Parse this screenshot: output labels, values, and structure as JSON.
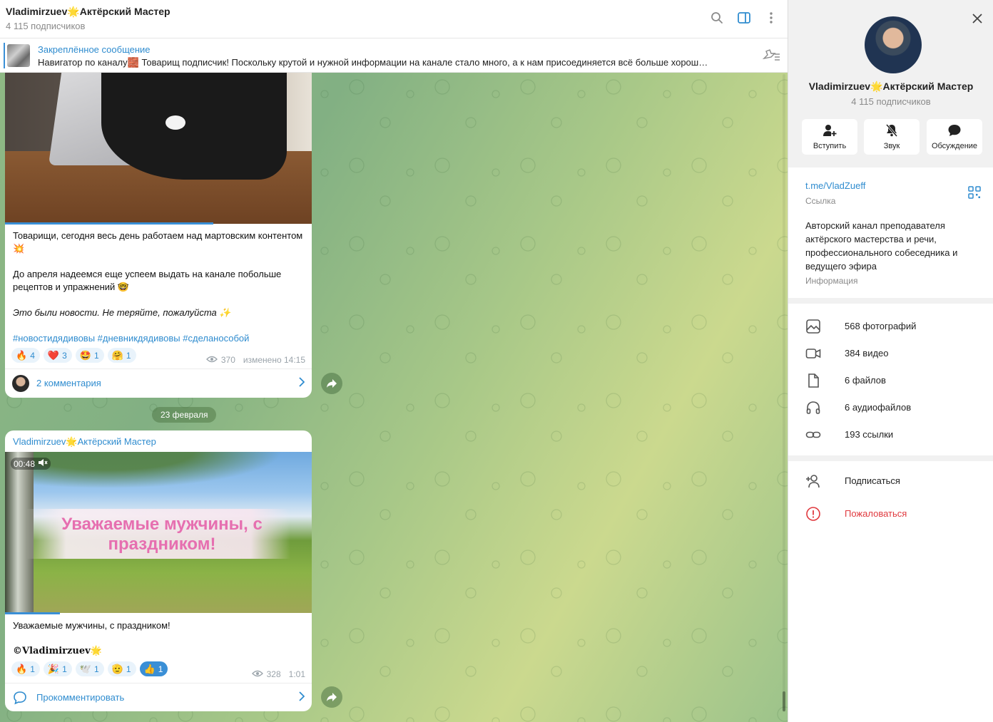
{
  "header": {
    "title": "Vladimirzuev🌟Актёрский Мастер",
    "subscribers": "4 115 подписчиков"
  },
  "pinned": {
    "title": "Закреплённое сообщение",
    "text": "Навигатор по каналу🧱 Товарищ подписчик!  Поскольку крутой и нужной информации на канале стало много, а к нам присоединяется всё больше хорош…"
  },
  "message1": {
    "lines": [
      "Товарищи, сегодня весь день работаем над мартовским контентом 💥",
      "До апреля надеемся еще успеем выдать на канале побольше рецептов и упражнений 🤓",
      "Это были новости. Не теряйте, пожалуйста ✨",
      "#новостидядивовы #дневникдядивовы #сделанособой"
    ],
    "reactions": [
      {
        "emoji": "🔥",
        "count": "4"
      },
      {
        "emoji": "❤️",
        "count": "3"
      },
      {
        "emoji": "🤩",
        "count": "1"
      },
      {
        "emoji": "🤗",
        "count": "1"
      }
    ],
    "views": "370",
    "edited": "изменено 14:15",
    "comments_label": "2 комментария",
    "video_progress": 0.68
  },
  "date_separator": "23 февраля",
  "message2": {
    "sender": "Vladimirzuev🌟Актёрский Мастер",
    "video_time": "00:48",
    "video_overlay_text": "Уважаемые мужчины, с праздником!",
    "video_progress": 0.18,
    "text_line1": "Уважаемые мужчины, с праздником!",
    "signature": "©𝐕𝐥𝐚𝐝𝐢𝐦𝐢𝐫𝐳𝐮𝐞𝐯🌟",
    "reactions": [
      {
        "emoji": "🔥",
        "count": "1"
      },
      {
        "emoji": "🎉",
        "count": "1"
      },
      {
        "emoji": "🕊️",
        "count": "1"
      },
      {
        "emoji": "🫡",
        "count": "1"
      },
      {
        "emoji": "👍",
        "count": "1",
        "active": true
      }
    ],
    "views": "328",
    "time": "1:01",
    "comment_label": "Прокомментировать"
  },
  "sidebar": {
    "name": "Vladimirzuev🌟Актёрский Мастер",
    "subscribers": "4 115 подписчиков",
    "actions": [
      "Вступить",
      "Звук",
      "Обсуждение"
    ],
    "link": "t.me/VladZueff",
    "link_label": "Ссылка",
    "description": "Авторский канал преподавателя актёрского мастерства и речи, профессионального собеседника и ведущего эфира",
    "description_label": "Информация",
    "media": [
      {
        "icon": "photo-icon",
        "label": "568 фотографий"
      },
      {
        "icon": "video-icon",
        "label": "384 видео"
      },
      {
        "icon": "file-icon",
        "label": "6 файлов"
      },
      {
        "icon": "headphones-icon",
        "label": "6 аудиофайлов"
      },
      {
        "icon": "link-icon",
        "label": "193 ссылки"
      }
    ],
    "subscribe": "Подписаться",
    "report": "Пожаловаться"
  },
  "colors": {
    "accent": "#2f8ccf",
    "danger": "#e0393e"
  }
}
